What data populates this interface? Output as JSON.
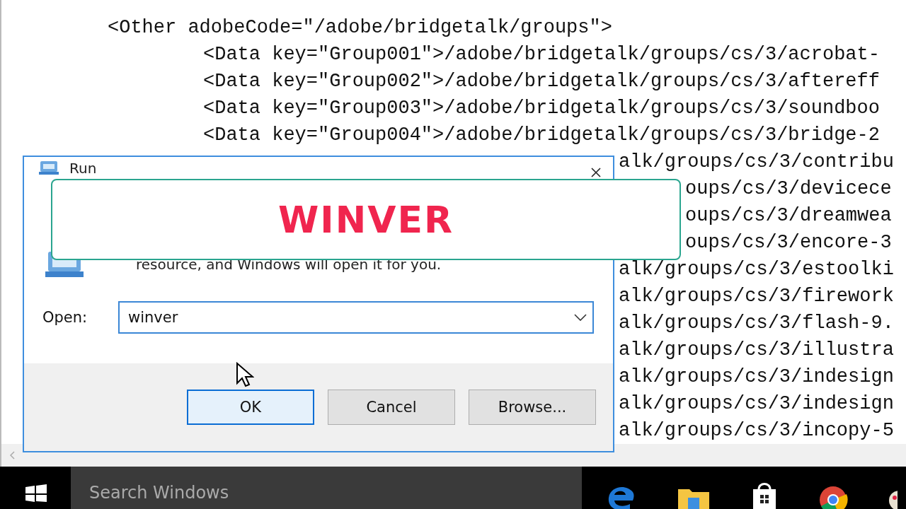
{
  "editor": {
    "lines": [
      {
        "kind": "outer",
        "text": "<Other adobeCode=\"/adobe/bridgetalk/groups\">"
      },
      {
        "kind": "inner",
        "text": "<Data key=\"Group001\">/adobe/bridgetalk/groups/cs/3/acrobat-"
      },
      {
        "kind": "inner",
        "text": "<Data key=\"Group002\">/adobe/bridgetalk/groups/cs/3/aftereff"
      },
      {
        "kind": "inner",
        "text": "<Data key=\"Group003\">/adobe/bridgetalk/groups/cs/3/soundboo"
      },
      {
        "kind": "inner",
        "text": "<Data key=\"Group004\">/adobe/bridgetalk/groups/cs/3/bridge-2"
      },
      {
        "kind": "behind",
        "text": "alk/groups/cs/3/contribu"
      },
      {
        "kind": "behind_overlay",
        "text": "oups/cs/3/devicece"
      },
      {
        "kind": "behind_overlay",
        "text": "oups/cs/3/dreamwea"
      },
      {
        "kind": "behind_overlay",
        "text": "oups/cs/3/encore-3"
      },
      {
        "kind": "behind",
        "text": "alk/groups/cs/3/estoolki"
      },
      {
        "kind": "behind",
        "text": "alk/groups/cs/3/firework"
      },
      {
        "kind": "behind",
        "text": "alk/groups/cs/3/flash-9."
      },
      {
        "kind": "behind",
        "text": "alk/groups/cs/3/illustra"
      },
      {
        "kind": "behind",
        "text": "alk/groups/cs/3/indesign"
      },
      {
        "kind": "behind",
        "text": "alk/groups/cs/3/indesign"
      },
      {
        "kind": "behind",
        "text": "alk/groups/cs/3/incopy-5"
      }
    ]
  },
  "run_dialog": {
    "title": "Run",
    "description": "resource, and Windows will open it for you.",
    "open_label": "Open:",
    "open_value": "winver",
    "buttons": [
      {
        "label": "OK",
        "focused": true
      },
      {
        "label": "Cancel",
        "focused": false
      },
      {
        "label": "Browse...",
        "focused": false
      }
    ]
  },
  "caption": {
    "text": "WINVER"
  },
  "taskbar": {
    "search": {
      "placeholder": "Search Windows"
    }
  }
}
